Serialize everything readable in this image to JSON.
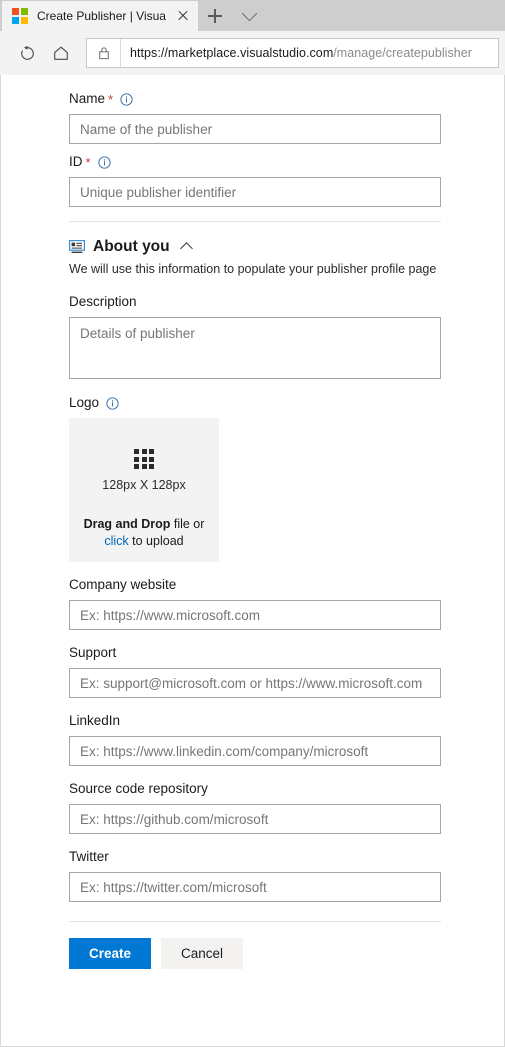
{
  "browser": {
    "tab": {
      "title": "Create Publisher | Visua",
      "favicon": "microsoft-logo-icon",
      "close_icon": "close-icon"
    },
    "new_tab_icon": "plus-icon",
    "tab_list_icon": "chevron-down-icon",
    "toolbar": {
      "reload_icon": "reload-icon",
      "home_icon": "home-icon",
      "lock_icon": "lock-icon",
      "url_host": "https://marketplace.visualstudio.com",
      "url_path": "/manage/createpublisher",
      "url_full": "https://marketplace.visualstudio.com/manage/createpublisher"
    }
  },
  "form": {
    "name": {
      "label": "Name",
      "required_mark": "*",
      "info_icon": "info-icon",
      "placeholder": "Name of the publisher",
      "value": ""
    },
    "id": {
      "label": "ID",
      "required_mark": "*",
      "info_icon": "info-icon",
      "placeholder": "Unique publisher identifier",
      "value": ""
    },
    "about_section": {
      "icon": "contact-card-icon",
      "title": "About you",
      "collapse_icon": "chevron-up-icon",
      "subtitle": "We will use this information to populate your publisher profile page"
    },
    "description": {
      "label": "Description",
      "placeholder": "Details of publisher",
      "value": ""
    },
    "logo": {
      "label": "Logo",
      "info_icon": "info-icon",
      "grid_icon": "grid-icon",
      "dimensions": "128px X 128px",
      "drag_strong": "Drag and Drop",
      "drag_rest": " file or",
      "click_link": "click",
      "click_rest": " to upload"
    },
    "company_website": {
      "label": "Company website",
      "placeholder": "Ex: https://www.microsoft.com",
      "value": ""
    },
    "support": {
      "label": "Support",
      "placeholder": "Ex: support@microsoft.com or https://www.microsoft.com",
      "value": ""
    },
    "linkedin": {
      "label": "LinkedIn",
      "placeholder": "Ex: https://www.linkedin.com/company/microsoft",
      "value": ""
    },
    "source_code": {
      "label": "Source code repository",
      "placeholder": "Ex: https://github.com/microsoft",
      "value": ""
    },
    "twitter": {
      "label": "Twitter",
      "placeholder": "Ex: https://twitter.com/microsoft",
      "value": ""
    }
  },
  "actions": {
    "create_label": "Create",
    "cancel_label": "Cancel"
  },
  "colors": {
    "primary": "#0078d4",
    "link": "#0067b8",
    "required": "#d13438",
    "dropzone_bg": "#f3f3f3"
  }
}
